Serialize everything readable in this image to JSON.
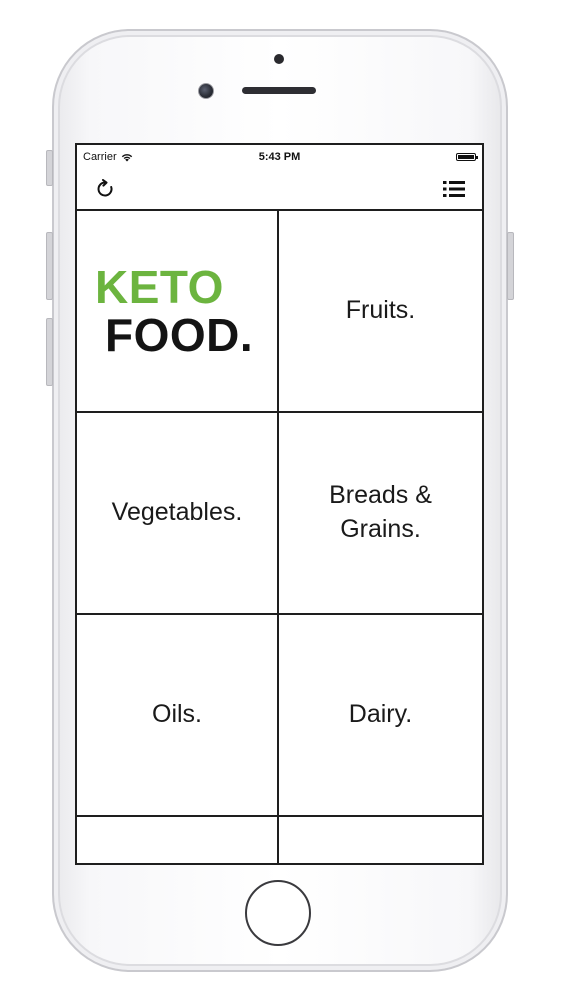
{
  "status_bar": {
    "carrier": "Carrier",
    "time": "5:43 PM"
  },
  "nav_bar": {
    "left_icon": "refresh-icon",
    "right_icon": "list-icon"
  },
  "logo": {
    "line1": "KETO",
    "line2": "FOOD.",
    "line1_color": "#6cb43f",
    "line2_color": "#141414"
  },
  "categories": [
    "Fruits.",
    "Vegetables.",
    "Breads & Grains.",
    "Oils.",
    "Dairy."
  ],
  "device": {
    "home_button_icon": "home-button"
  }
}
